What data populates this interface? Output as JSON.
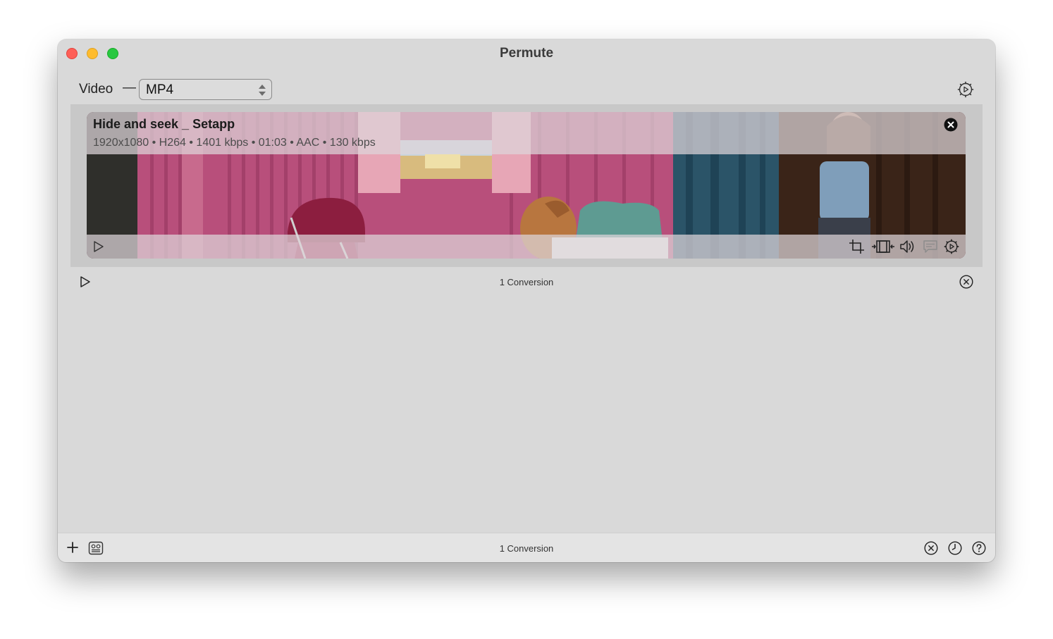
{
  "window": {
    "title": "Permute"
  },
  "format": {
    "label": "Video",
    "separator": "—",
    "selected": "MP4"
  },
  "item": {
    "title": "Hide and seek _ Setapp",
    "meta": "1920x1080 • H264 • 1401 kbps • 01:03 • AAC • 130 kbps"
  },
  "queue": {
    "count_label": "1 Conversion"
  },
  "footer": {
    "count_label": "1 Conversion"
  },
  "icons": {
    "format_settings": "gear-play-icon",
    "item_remove": "close-filled-icon",
    "item_play": "play-icon",
    "tools": [
      "crop-icon",
      "trim-icon",
      "audio-icon",
      "subtitles-icon",
      "settings-icon"
    ],
    "queue_play": "play-icon",
    "queue_cancel": "cancel-circle-icon",
    "footer": [
      "add-icon",
      "queue-icon",
      "cancel-circle-icon",
      "history-icon",
      "help-icon"
    ]
  },
  "colors": {
    "window_bg": "#d9d9d9",
    "list_bg": "#c8c8c8",
    "close_light": "#fe5f57",
    "minimize_light": "#febc2e",
    "zoom_light": "#28c840"
  }
}
